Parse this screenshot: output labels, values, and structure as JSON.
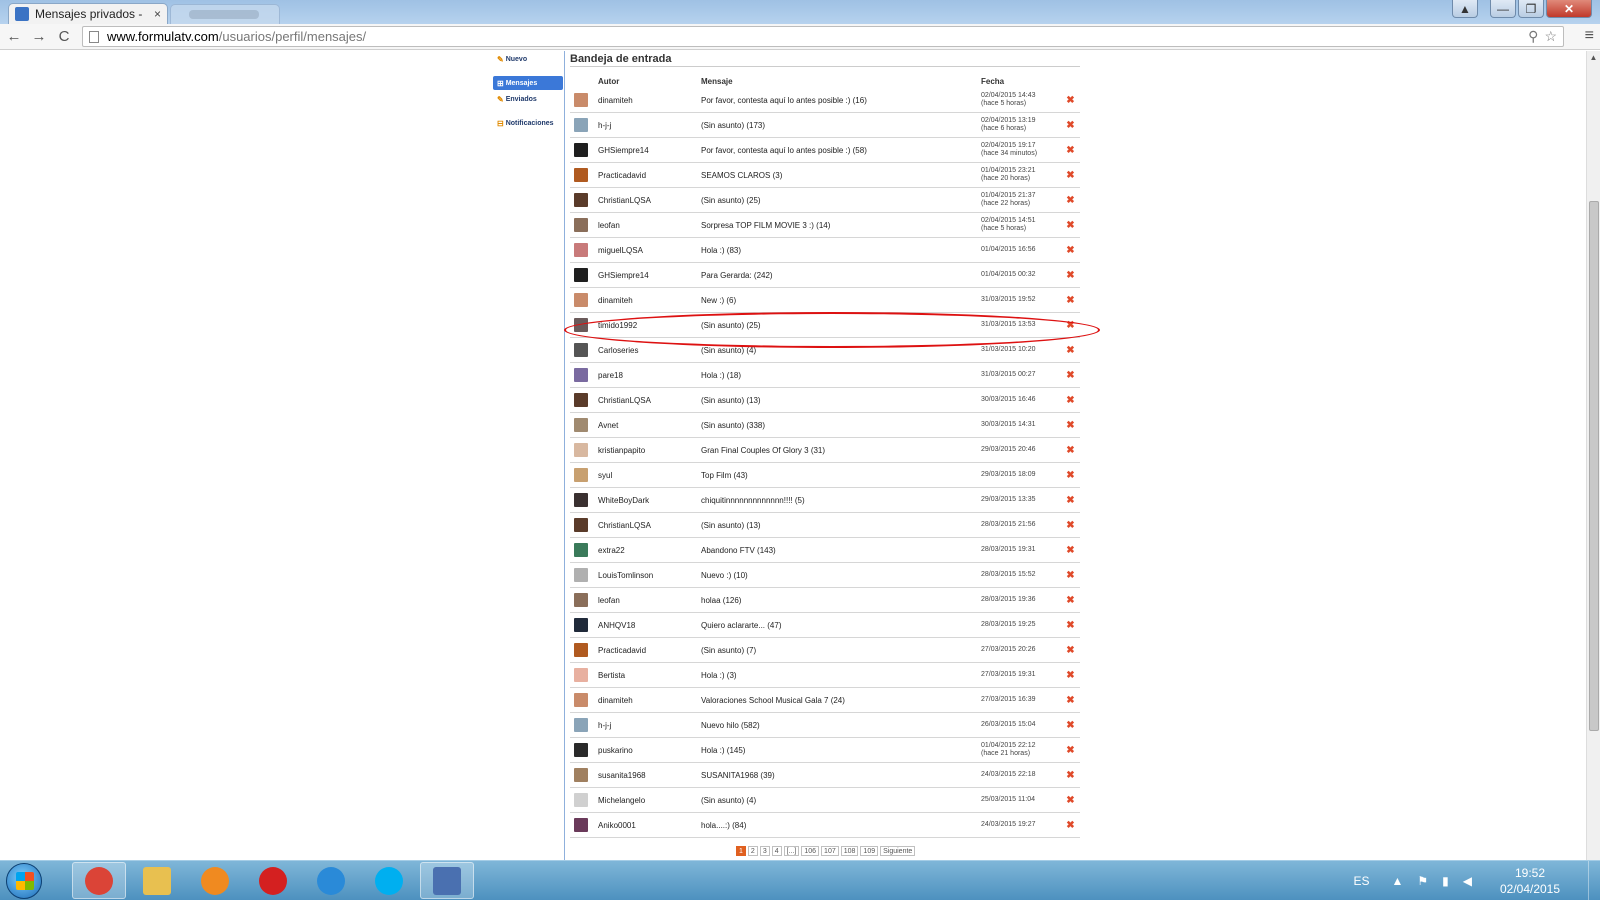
{
  "browser": {
    "tab_title": "Mensajes privados -",
    "tab_close": "×",
    "url_domain": "www.formulatv.com",
    "url_path": "/usuarios/perfil/mensajes/",
    "back": "←",
    "forward": "→",
    "reload": "C",
    "menu": "≡",
    "search_icon": "⚲",
    "star_icon": "☆",
    "minimize": "—",
    "maximize": "❐",
    "close": "✕",
    "user_icon": "▲"
  },
  "sidebar": {
    "items": [
      {
        "label": "Nuevo",
        "icon": "✎"
      },
      {
        "label": "Mensajes",
        "icon": "⊞"
      },
      {
        "label": "Enviados",
        "icon": "✎"
      },
      {
        "label": "Notificaciones",
        "icon": "⊟"
      }
    ]
  },
  "inbox": {
    "title": "Bandeja de entrada",
    "headers": {
      "author": "Autor",
      "message": "Mensaje",
      "date": "Fecha"
    },
    "delete_symbol": "✖",
    "rows": [
      {
        "author": "dinamiteh",
        "message": "Por favor, contesta aquí lo antes posible :) (16)",
        "date": "02/04/2015 14:43",
        "ago": "(hace 5 horas)",
        "avatar_color": "#c98b6a"
      },
      {
        "author": "h-j-j",
        "message": "(Sin asunto) (173)",
        "date": "02/04/2015 13:19",
        "ago": "(hace 6 horas)",
        "avatar_color": "#8aa4b8"
      },
      {
        "author": "GHSiempre14",
        "message": "Por favor, contesta aquí lo antes posible :) (58)",
        "date": "02/04/2015 19:17",
        "ago": "(hace 34 minutos)",
        "avatar_color": "#1f1f1f"
      },
      {
        "author": "Practicadavid",
        "message": "SEAMOS CLAROS (3)",
        "date": "01/04/2015 23:21",
        "ago": "(hace 20 horas)",
        "avatar_color": "#b05a20"
      },
      {
        "author": "ChristianLQSA",
        "message": "(Sin asunto) (25)",
        "date": "01/04/2015 21:37",
        "ago": "(hace 22 horas)",
        "avatar_color": "#5a3b2a"
      },
      {
        "author": "leofan",
        "message": "Sorpresa TOP FILM MOVIE 3 :) (14)",
        "date": "02/04/2015 14:51",
        "ago": "(hace 5 horas)",
        "avatar_color": "#8a6e5a"
      },
      {
        "author": "miguelLQSA",
        "message": "Hola :) (83)",
        "date": "01/04/2015 16:56",
        "ago": "",
        "avatar_color": "#c87a7a"
      },
      {
        "author": "GHSiempre14",
        "message": "Para Gerarda: (242)",
        "date": "01/04/2015 00:32",
        "ago": "",
        "avatar_color": "#1f1f1f"
      },
      {
        "author": "dinamiteh",
        "message": "New :) (6)",
        "date": "31/03/2015 19:52",
        "ago": "",
        "avatar_color": "#c98b6a"
      },
      {
        "author": "timido1992",
        "message": "(Sin asunto) (25)",
        "date": "31/03/2015 13:53",
        "ago": "",
        "avatar_color": "#6a5a5a"
      },
      {
        "author": "Carloseries",
        "message": "(Sin asunto) (4)",
        "date": "31/03/2015 10:20",
        "ago": "",
        "avatar_color": "#555555"
      },
      {
        "author": "pare18",
        "message": "Hola :) (18)",
        "date": "31/03/2015 00:27",
        "ago": "",
        "avatar_color": "#7a6aa0"
      },
      {
        "author": "ChristianLQSA",
        "message": "(Sin asunto) (13)",
        "date": "30/03/2015 16:46",
        "ago": "",
        "avatar_color": "#5a3b2a"
      },
      {
        "author": "Avnet",
        "message": "(Sin asunto) (338)",
        "date": "30/03/2015 14:31",
        "ago": "",
        "avatar_color": "#a08a70"
      },
      {
        "author": "kristianpapito",
        "message": "Gran Final Couples Of Glory 3 (31)",
        "date": "29/03/2015 20:46",
        "ago": "",
        "avatar_color": "#d8b8a0"
      },
      {
        "author": "syul",
        "message": "Top Film (43)",
        "date": "29/03/2015 18:09",
        "ago": "",
        "avatar_color": "#c8a070"
      },
      {
        "author": "WhiteBoyDark",
        "message": "chiquitinnnnnnnnnnnnn!!!! (5)",
        "date": "29/03/2015 13:35",
        "ago": "",
        "avatar_color": "#3a3030"
      },
      {
        "author": "ChristianLQSA",
        "message": "(Sin asunto) (13)",
        "date": "28/03/2015 21:56",
        "ago": "",
        "avatar_color": "#5a3b2a"
      },
      {
        "author": "extra22",
        "message": "Abandono FTV (143)",
        "date": "28/03/2015 19:31",
        "ago": "",
        "avatar_color": "#3a7a5a"
      },
      {
        "author": "LouisTomlinson",
        "message": "Nuevo :) (10)",
        "date": "28/03/2015 15:52",
        "ago": "",
        "avatar_color": "#b0b0b0"
      },
      {
        "author": "leofan",
        "message": "holaa (126)",
        "date": "28/03/2015 19:36",
        "ago": "",
        "avatar_color": "#8a6e5a"
      },
      {
        "author": "ANHQV18",
        "message": "Quiero aclararte... (47)",
        "date": "28/03/2015 19:25",
        "ago": "",
        "avatar_color": "#202a3a"
      },
      {
        "author": "Practicadavid",
        "message": "(Sin asunto) (7)",
        "date": "27/03/2015 20:26",
        "ago": "",
        "avatar_color": "#b05a20"
      },
      {
        "author": "Bertista",
        "message": "Hola :) (3)",
        "date": "27/03/2015 19:31",
        "ago": "",
        "avatar_color": "#e8b0a0"
      },
      {
        "author": "dinamiteh",
        "message": "Valoraciones School Musical Gala 7 (24)",
        "date": "27/03/2015 16:39",
        "ago": "",
        "avatar_color": "#c98b6a"
      },
      {
        "author": "h-j-j",
        "message": "Nuevo hilo (582)",
        "date": "26/03/2015 15:04",
        "ago": "",
        "avatar_color": "#8aa4b8"
      },
      {
        "author": "puskarino",
        "message": "Hola :) (145)",
        "date": "01/04/2015 22:12",
        "ago": "(hace 21 horas)",
        "avatar_color": "#2a2a2a"
      },
      {
        "author": "susanita1968",
        "message": "SUSANITA1968 (39)",
        "date": "24/03/2015 22:18",
        "ago": "",
        "avatar_color": "#a08060"
      },
      {
        "author": "Michelangelo",
        "message": "(Sin asunto) (4)",
        "date": "25/03/2015 11:04",
        "ago": "",
        "avatar_color": "#d0d0d0"
      },
      {
        "author": "Aniko0001",
        "message": "hola....:) (84)",
        "date": "24/03/2015 19:27",
        "ago": "",
        "avatar_color": "#6a3a5a"
      }
    ]
  },
  "pager": [
    "1",
    "2",
    "3",
    "4",
    "[...]",
    "106",
    "107",
    "108",
    "109",
    "Siguiente"
  ],
  "taskbar": {
    "language": "ES",
    "time": "19:52",
    "date": "02/04/2015",
    "apps": [
      {
        "name": "chrome",
        "color": "#db4437"
      },
      {
        "name": "explorer",
        "color": "#e8c050"
      },
      {
        "name": "media-player",
        "color": "#f08a20"
      },
      {
        "name": "acrobat",
        "color": "#d42020"
      },
      {
        "name": "internet-explorer",
        "color": "#2a8ad8"
      },
      {
        "name": "skype",
        "color": "#00aff0"
      },
      {
        "name": "app",
        "color": "#4a70b0"
      }
    ]
  }
}
